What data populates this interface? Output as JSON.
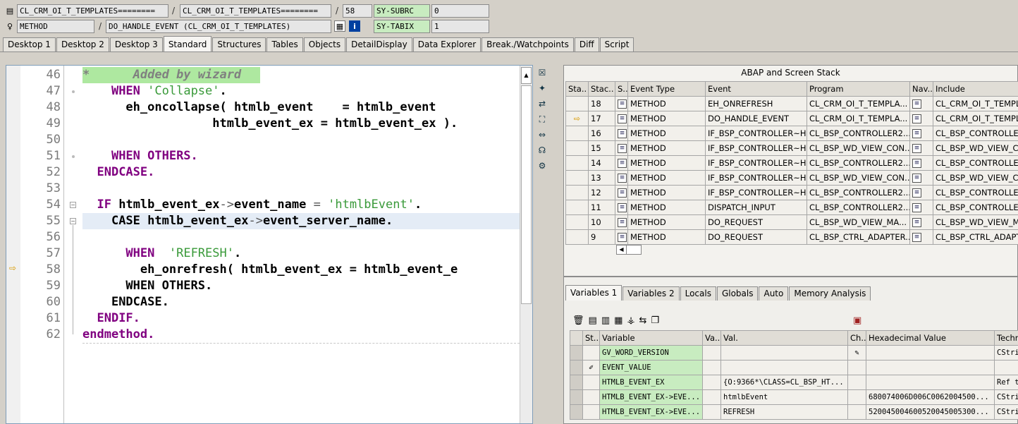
{
  "toolbar": {
    "row1": {
      "field_a": "CL_CRM_OI_T_TEMPLATES========",
      "sep1": "/",
      "field_b": "CL_CRM_OI_T_TEMPLATES========",
      "sep2": "/",
      "line": "58",
      "sysvar": "SY-SUBRC",
      "sysval": "0"
    },
    "row2": {
      "field_a": "METHOD",
      "sep1": "/",
      "field_b": "DO_HANDLE_EVENT (CL_CRM_OI_T_TEMPLATES)",
      "sysvar": "SY-TABIX",
      "sysval": "1"
    }
  },
  "tabs": [
    "Desktop 1",
    "Desktop 2",
    "Desktop 3",
    "Standard",
    "Structures",
    "Tables",
    "Objects",
    "DetailDisplay",
    "Data Explorer",
    "Break./Watchpoints",
    "Diff",
    "Script"
  ],
  "editor": {
    "line_numbers": [
      "46",
      "47",
      "48",
      "49",
      "50",
      "51",
      "52",
      "53",
      "54",
      "55",
      "56",
      "57",
      "58",
      "59",
      "60",
      "61",
      "62"
    ],
    "lines": {
      "l46": "*      Added by wizard",
      "l47_kw": "WHEN",
      "l47_str": "'Collapse'",
      "l48_a": "eh_oncollapse( htmlb_event",
      "l48_b": "= htmlb_event",
      "l49": "htmlb_event_ex = htmlb_event_ex ).",
      "l51_kw": "WHEN OTHERS.",
      "l52": "ENDCASE.",
      "l54_kw": "IF",
      "l54_a": "htmlb_event_ex",
      "l54_b": "event_name",
      "l54_str": "'htmlbEvent'",
      "l55_kw": "CASE",
      "l55_a": "htmlb_event_ex",
      "l55_b": "event_server_name",
      "l57_kw": "WHEN",
      "l57_str": "'REFRESH'",
      "l58": "eh_onrefresh( htmlb_event_ex = htmlb_event_e",
      "l59": "WHEN OTHERS.",
      "l60": "ENDCASE.",
      "l61": "ENDIF.",
      "l62": "endmethod."
    }
  },
  "stack": {
    "title": "ABAP and Screen Stack",
    "columns": [
      "Sta..",
      "Stac..",
      "S..",
      "Event Type",
      "Event",
      "Program",
      "Nav..",
      "Include"
    ],
    "rows": [
      {
        "level": "18",
        "type": "METHOD",
        "event": "EH_ONREFRESH",
        "program": "CL_CRM_OI_T_TEMPLA...",
        "include": "CL_CRM_OI_T_TEMPL"
      },
      {
        "level": "17",
        "type": "METHOD",
        "event": "DO_HANDLE_EVENT",
        "program": "CL_CRM_OI_T_TEMPLA...",
        "include": "CL_CRM_OI_T_TEMPL"
      },
      {
        "level": "16",
        "type": "METHOD",
        "event": "IF_BSP_CONTROLLER~H...",
        "program": "CL_BSP_CONTROLLER2...",
        "include": "CL_BSP_CONTROLLE"
      },
      {
        "level": "15",
        "type": "METHOD",
        "event": "IF_BSP_CONTROLLER~H...",
        "program": "CL_BSP_WD_VIEW_CON...",
        "include": "CL_BSP_WD_VIEW_C"
      },
      {
        "level": "14",
        "type": "METHOD",
        "event": "IF_BSP_CONTROLLER~H...",
        "program": "CL_BSP_CONTROLLER2...",
        "include": "CL_BSP_CONTROLLE"
      },
      {
        "level": "13",
        "type": "METHOD",
        "event": "IF_BSP_CONTROLLER~H...",
        "program": "CL_BSP_WD_VIEW_CON...",
        "include": "CL_BSP_WD_VIEW_C"
      },
      {
        "level": "12",
        "type": "METHOD",
        "event": "IF_BSP_CONTROLLER~H...",
        "program": "CL_BSP_CONTROLLER2...",
        "include": "CL_BSP_CONTROLLE"
      },
      {
        "level": "11",
        "type": "METHOD",
        "event": "DISPATCH_INPUT",
        "program": "CL_BSP_CONTROLLER2...",
        "include": "CL_BSP_CONTROLLE"
      },
      {
        "level": "10",
        "type": "METHOD",
        "event": "DO_REQUEST",
        "program": "CL_BSP_WD_VIEW_MA...",
        "include": "CL_BSP_WD_VIEW_M"
      },
      {
        "level": "9",
        "type": "METHOD",
        "event": "DO_REQUEST",
        "program": "CL_BSP_CTRL_ADAPTER...",
        "include": "CL_BSP_CTRL_ADAPT"
      }
    ]
  },
  "var_tabs": [
    "Variables 1",
    "Variables 2",
    "Locals",
    "Globals",
    "Auto",
    "Memory Analysis"
  ],
  "vars": {
    "columns": [
      "St..",
      "Variable",
      "Va..",
      "Val.",
      "Ch..",
      "Hexadecimal Value",
      "Techn"
    ],
    "rows": [
      {
        "name": "GV_WORD_VERSION",
        "val": "",
        "hex": "",
        "tech": "CStrin"
      },
      {
        "name": "EVENT_VALUE",
        "val": "",
        "hex": "",
        "tech": ""
      },
      {
        "name": "HTMLB_EVENT_EX",
        "val": "{O:9366*\\CLASS=CL_BSP_HT...",
        "hex": "",
        "tech": "Ref to"
      },
      {
        "name": "HTMLB_EVENT_EX->EVE...",
        "val": "htmlbEvent",
        "hex": "680074006D006C0062004500...",
        "tech": "CStrin"
      },
      {
        "name": "HTMLB_EVENT_EX->EVE...",
        "val": "REFRESH",
        "hex": "520045004600520045005300...",
        "tech": "CStrin"
      }
    ]
  }
}
